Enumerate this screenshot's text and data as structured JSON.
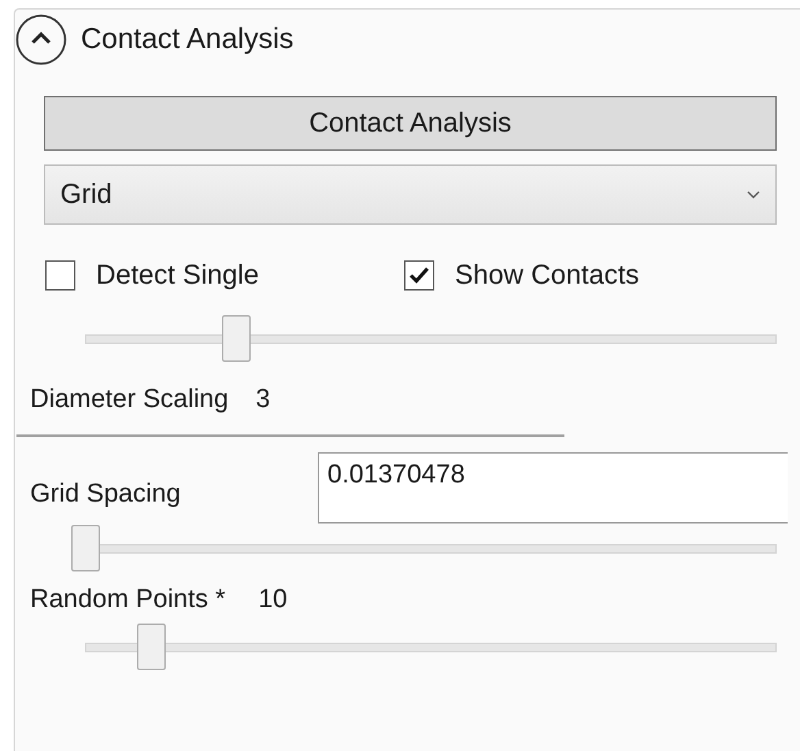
{
  "section": {
    "title": "Contact Analysis",
    "expanded": true
  },
  "action_button": {
    "label": "Contact Analysis"
  },
  "method_dropdown": {
    "value": "Grid"
  },
  "checkboxes": [
    {
      "label": "Detect Single",
      "checked": false
    },
    {
      "label": "Show Contacts",
      "checked": true
    }
  ],
  "diameter_slider": {
    "level": 0.223
  },
  "diameter_scaling": {
    "label": "Diameter Scaling",
    "value": "3"
  },
  "grid_spacing": {
    "label": "Grid Spacing",
    "value": "0.01370478"
  },
  "grid_slider": {
    "level": 0
  },
  "random_points": {
    "label": "Random Points *",
    "value": "10"
  },
  "random_slider": {
    "level": 0.097
  }
}
